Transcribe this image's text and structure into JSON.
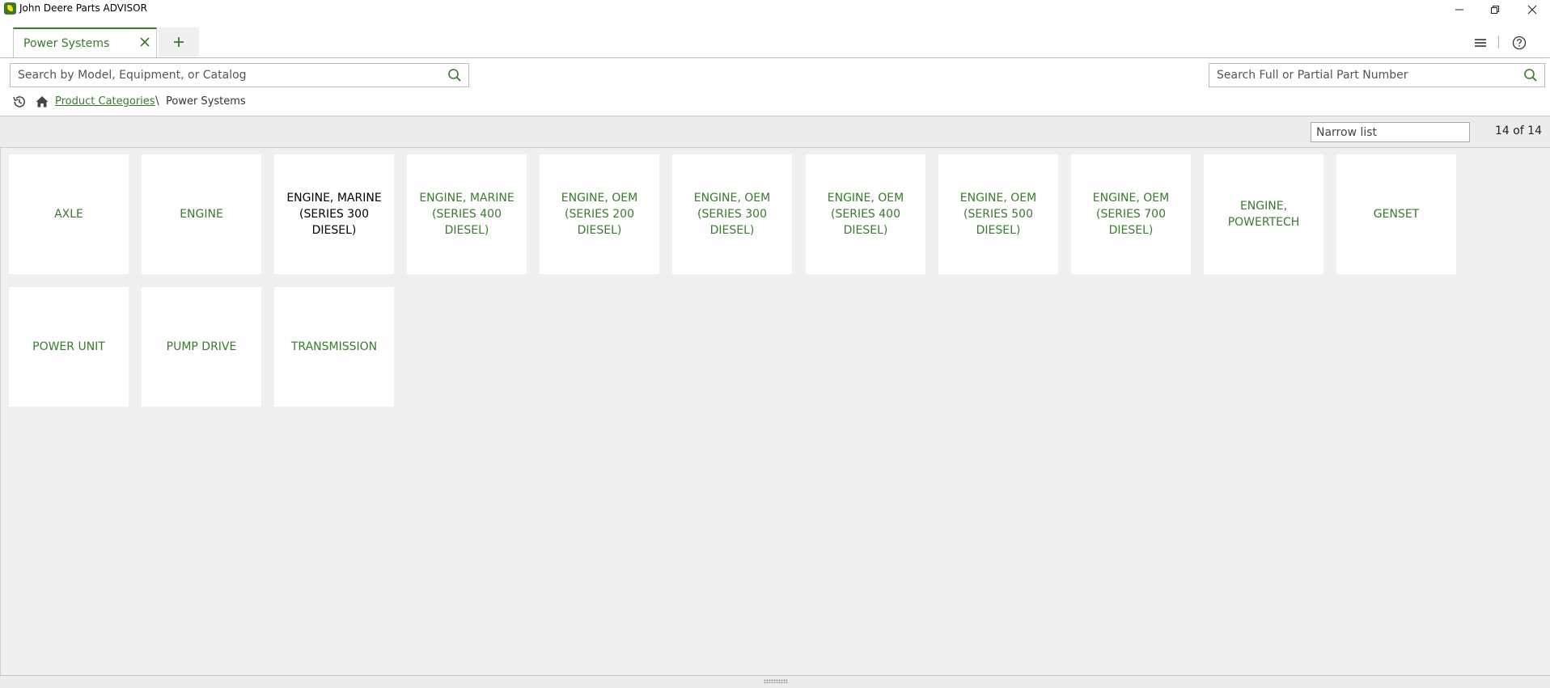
{
  "window": {
    "title": "John Deere Parts ADVISOR",
    "icons": [
      "app-logo-icon",
      "minimize-icon",
      "restore-icon",
      "close-icon"
    ]
  },
  "tabs": [
    {
      "label": "Power Systems",
      "active": true
    }
  ],
  "toolbar": {
    "icons": [
      "menu-icon",
      "help-icon"
    ]
  },
  "search": {
    "model_placeholder": "Search by Model, Equipment, or Catalog",
    "part_placeholder": "Search Full or Partial Part Number"
  },
  "breadcrumb": {
    "root": "Product Categories",
    "separator": "\\",
    "current": "Power Systems"
  },
  "filter": {
    "placeholder": "Narrow list",
    "count": "14 of 14"
  },
  "tiles": [
    {
      "label": "AXLE",
      "visited": false
    },
    {
      "label": "ENGINE",
      "visited": false
    },
    {
      "label": "ENGINE, MARINE (SERIES 300 DIESEL)",
      "visited": true
    },
    {
      "label": "ENGINE, MARINE (SERIES 400 DIESEL)",
      "visited": false
    },
    {
      "label": "ENGINE, OEM (SERIES 200 DIESEL)",
      "visited": false
    },
    {
      "label": "ENGINE, OEM (SERIES 300 DIESEL)",
      "visited": false
    },
    {
      "label": "ENGINE, OEM (SERIES 400 DIESEL)",
      "visited": false
    },
    {
      "label": "ENGINE, OEM (SERIES 500 DIESEL)",
      "visited": false
    },
    {
      "label": "ENGINE, OEM (SERIES 700 DIESEL)",
      "visited": false
    },
    {
      "label": "ENGINE, POWERTECH",
      "visited": false
    },
    {
      "label": "GENSET",
      "visited": false
    },
    {
      "label": "POWER UNIT",
      "visited": false
    },
    {
      "label": "PUMP DRIVE",
      "visited": false
    },
    {
      "label": "TRANSMISSION",
      "visited": false
    }
  ],
  "colors": {
    "brand_green": "#367c2b",
    "brand_yellow": "#ffde00",
    "visited_text": "#000000"
  }
}
